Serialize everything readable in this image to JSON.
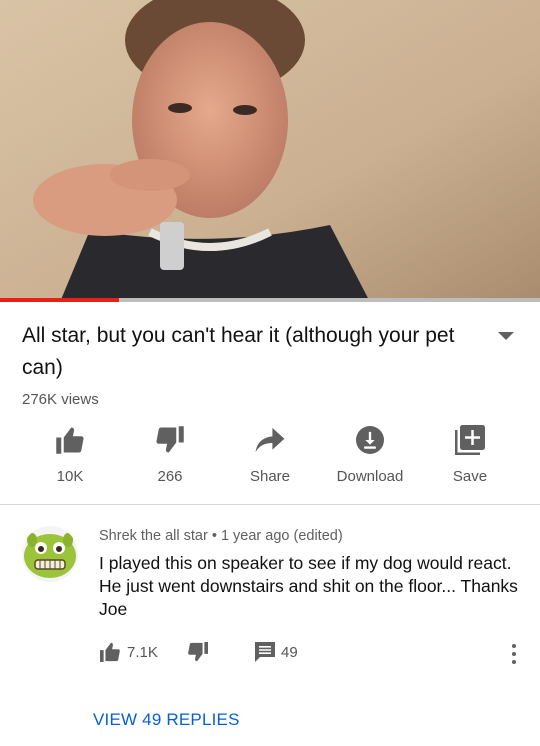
{
  "video": {
    "progress_fraction": 0.22,
    "accent_color": "#e62117"
  },
  "title": "All star, but you can't hear it (although your pet can)",
  "views": "276K views",
  "actions": {
    "like_count": "10K",
    "dislike_count": "266",
    "share_label": "Share",
    "download_label": "Download",
    "save_label": "Save"
  },
  "comment": {
    "author": "Shrek the all star",
    "separator": "•",
    "time": "1 year ago (edited)",
    "text": "I played this on speaker to see if my dog would react. He just went downstairs and shit on the floor... Thanks Joe",
    "like_count": "7.1K",
    "reply_count": "49",
    "view_replies": "VIEW 49 REPLIES"
  },
  "icons": {
    "like": "thumbs-up-icon",
    "dislike": "thumbs-down-icon",
    "share": "share-arrow-icon",
    "download": "download-circle-icon",
    "save": "add-to-playlist-icon",
    "reply": "comment-bubble-icon",
    "more": "more-vertical-icon"
  }
}
